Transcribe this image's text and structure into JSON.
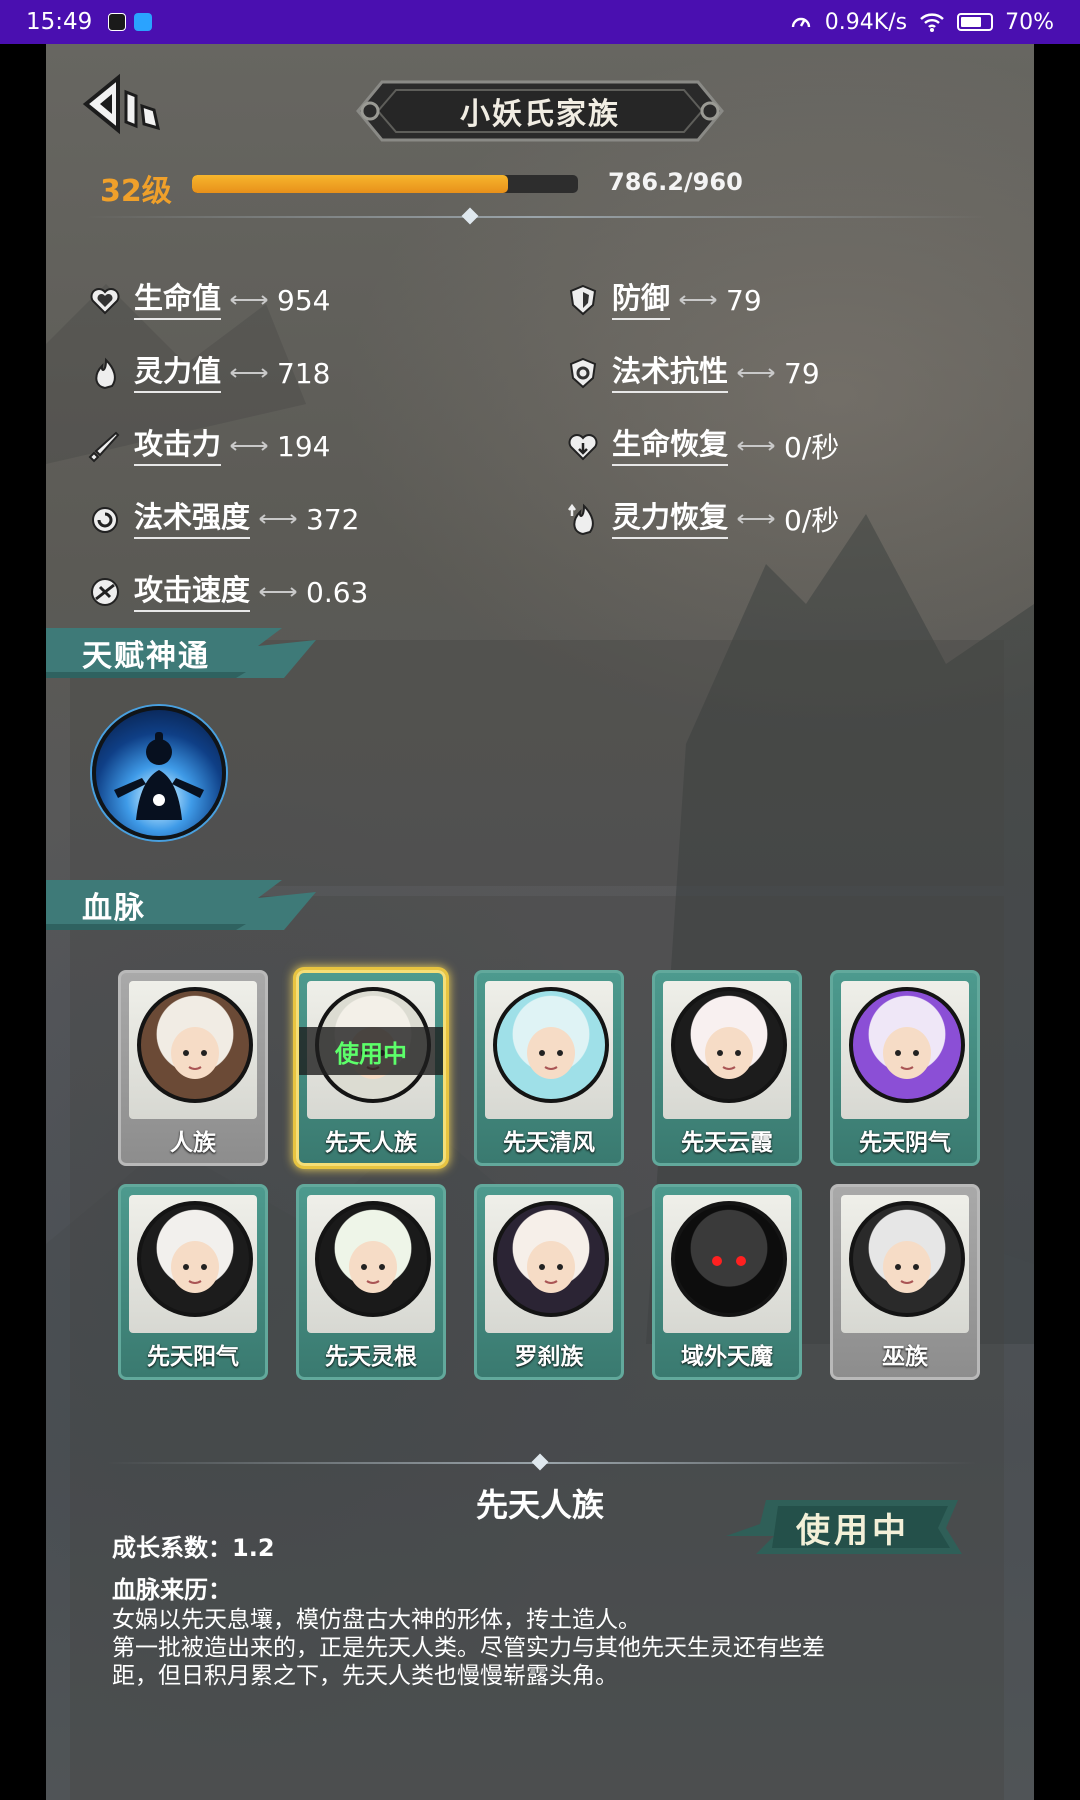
{
  "status_bar": {
    "time": "15:49",
    "network_speed": "0.94K/s",
    "battery": "70%"
  },
  "header": {
    "title": "小妖氏家族",
    "level": "32级",
    "xp_text": "786.2/960",
    "xp_fraction": 0.819
  },
  "stats_left": [
    {
      "name": "生命值",
      "value": "954",
      "icon": "heart-icon"
    },
    {
      "name": "灵力值",
      "value": "718",
      "icon": "flame-icon"
    },
    {
      "name": "攻击力",
      "value": "194",
      "icon": "sword-icon"
    },
    {
      "name": "法术强度",
      "value": "372",
      "icon": "swirl-icon"
    },
    {
      "name": "攻击速度",
      "value": "0.63",
      "icon": "speed-icon"
    }
  ],
  "stats_right": [
    {
      "name": "防御",
      "value": "79",
      "icon": "shield-icon"
    },
    {
      "name": "法术抗性",
      "value": "79",
      "icon": "magic-shield-icon"
    },
    {
      "name": "生命恢复",
      "value": "0/秒",
      "icon": "heart-regen-icon"
    },
    {
      "name": "灵力恢复",
      "value": "0/秒",
      "icon": "flame-regen-icon"
    }
  ],
  "talent": {
    "section_title": "天赋神通"
  },
  "bloodline": {
    "section_title": "血脉",
    "cards": [
      {
        "label": "人族",
        "style": "grey"
      },
      {
        "label": "先天人族",
        "style": "teal",
        "selected": true,
        "tag": "使用中"
      },
      {
        "label": "先天清风",
        "style": "teal"
      },
      {
        "label": "先天云霞",
        "style": "teal"
      },
      {
        "label": "先天阴气",
        "style": "teal"
      },
      {
        "label": "先天阳气",
        "style": "teal"
      },
      {
        "label": "先天灵根",
        "style": "teal"
      },
      {
        "label": "罗刹族",
        "style": "teal"
      },
      {
        "label": "域外天魔",
        "style": "teal"
      },
      {
        "label": "巫族",
        "style": "grey"
      }
    ]
  },
  "detail": {
    "title": "先天人族",
    "status_banner": "使用中",
    "growth_line": "成长系数：1.2",
    "origin_label": "血脉来历：",
    "description_lines": [
      "女娲以先天息壤，模仿盘古大神的形体，抟土造人。",
      "第一批被造出来的，正是先天人类。尽管实力与其他先天生灵还有些差",
      "距，但日积月累之下，先天人类也慢慢崭露头角。"
    ]
  },
  "colors": {
    "accent": "#f0a02a",
    "teal": "#4d9a8e",
    "inuse_green": "#5cff6a",
    "status_bar": "#4a0fb0"
  }
}
